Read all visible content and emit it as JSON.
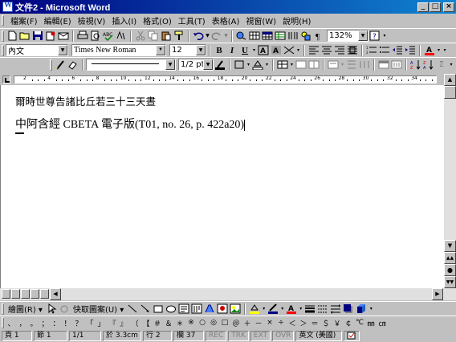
{
  "window": {
    "title": "文件2 - Microsoft Word",
    "minimize": "_",
    "maximize": "□",
    "close": "×"
  },
  "menu": {
    "items": [
      "檔案(F)",
      "編輯(E)",
      "檢視(V)",
      "插入(I)",
      "格式(O)",
      "工具(T)",
      "表格(A)",
      "視窗(W)",
      "說明(H)"
    ]
  },
  "toolbar_standard": {
    "zoom": "132%"
  },
  "toolbar_format": {
    "style": "內文",
    "font": "Times New Roman",
    "size": "12"
  },
  "toolbar_lines": {
    "line_weight": "1/2 pt"
  },
  "ruler": {
    "labels": [
      "2",
      "4",
      "6",
      "8",
      "10",
      "12",
      "14",
      "16",
      "18",
      "20",
      "22",
      "24",
      "26",
      "28",
      "30",
      "32",
      "34"
    ]
  },
  "document": {
    "line1": "爾時世尊告諸比丘若三十三天晝",
    "line2": "中阿含經 CBETA 電子版(T01, no. 26, p. 422a20)"
  },
  "drawing_toolbar": {
    "draw_label": "繪圖(R) ▾",
    "autoshapes_label": "快取圖案(U) ▾"
  },
  "symbols": [
    "、",
    "，",
    "。",
    "；",
    "：",
    "！",
    "？",
    "「",
    "」",
    "『",
    "』",
    "（",
    "【",
    "＃",
    "＆",
    "＊",
    "※",
    "○",
    "◎",
    "□",
    "＠",
    "＋",
    "－",
    "×",
    "÷",
    "＜",
    "＞",
    "＝",
    "＄",
    "￥",
    "￠",
    "℃",
    "㎜",
    "㎝"
  ],
  "status": {
    "page": "頁 1",
    "section": "節 1",
    "page_of": "1/1",
    "position": "於 3.3cm",
    "line": "行 2",
    "column": "欄 37",
    "rec": "REC",
    "trk": "TRK",
    "ext": "EXT",
    "ovr": "OVR",
    "language": "英文 (美國)"
  },
  "colors": {
    "titlebar": "#000080",
    "face": "#c0c0c0",
    "highlight_yellow": "#ffff00",
    "font_red": "#ff0000"
  }
}
